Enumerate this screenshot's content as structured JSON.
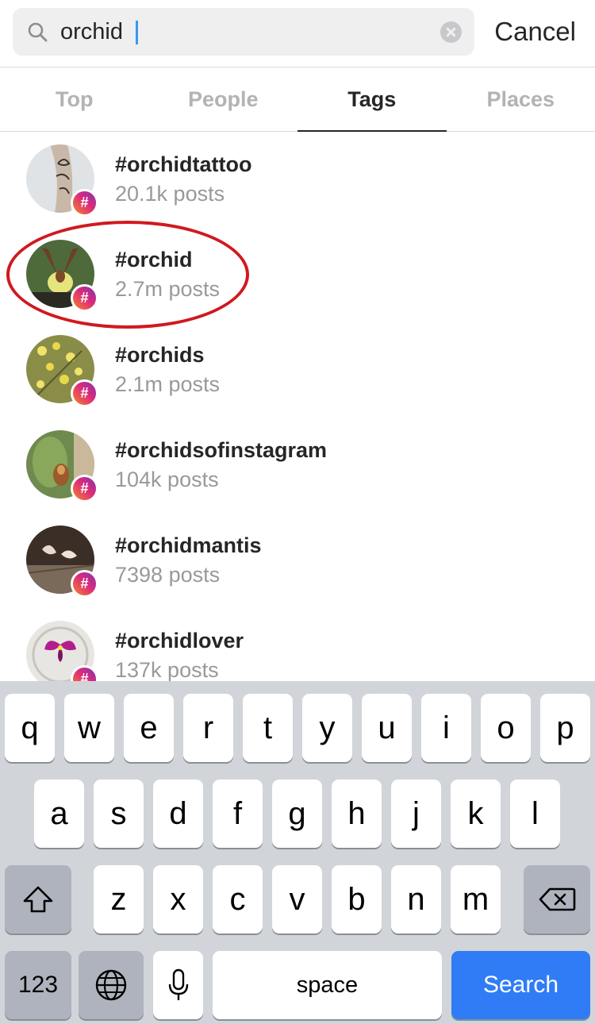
{
  "search": {
    "value": "orchid",
    "cancel_label": "Cancel"
  },
  "tabs": [
    {
      "label": "Top",
      "active": false
    },
    {
      "label": "People",
      "active": false
    },
    {
      "label": "Tags",
      "active": true
    },
    {
      "label": "Places",
      "active": false
    }
  ],
  "results": [
    {
      "tag": "#orchidtattoo",
      "posts": "20.1k posts"
    },
    {
      "tag": "#orchid",
      "posts": "2.7m posts",
      "highlighted": true
    },
    {
      "tag": "#orchids",
      "posts": "2.1m posts"
    },
    {
      "tag": "#orchidsofinstagram",
      "posts": "104k posts"
    },
    {
      "tag": "#orchidmantis",
      "posts": "7398 posts"
    },
    {
      "tag": "#orchidlover",
      "posts": "137k posts"
    }
  ],
  "hashtag_badge_symbol": "#",
  "keyboard": {
    "row1": [
      "q",
      "w",
      "e",
      "r",
      "t",
      "y",
      "u",
      "i",
      "o",
      "p"
    ],
    "row2": [
      "a",
      "s",
      "d",
      "f",
      "g",
      "h",
      "j",
      "k",
      "l"
    ],
    "row3": [
      "z",
      "x",
      "c",
      "v",
      "b",
      "n",
      "m"
    ],
    "numbers_label": "123",
    "space_label": "space",
    "search_label": "Search"
  },
  "colors": {
    "accent_blue": "#2f7cf6",
    "highlight_red": "#d0191f",
    "tab_inactive": "#b3b3b3"
  }
}
